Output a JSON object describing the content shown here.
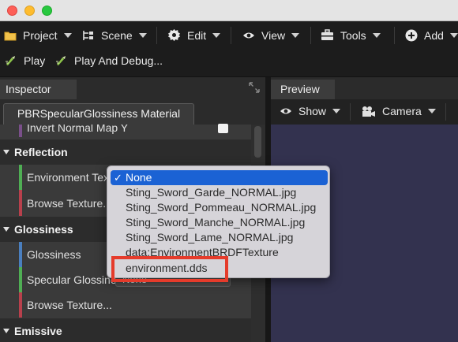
{
  "toolbar": {
    "project": "Project",
    "scene": "Scene",
    "edit": "Edit",
    "view": "View",
    "tools": "Tools",
    "add": "Add",
    "play": "Play",
    "play_debug": "Play And Debug..."
  },
  "inspector": {
    "tab": "Inspector",
    "material_tab": "PBRSpecularGlossiness Material",
    "rows": {
      "invert_normal": "Invert Normal Map Y",
      "reflection": "Reflection",
      "environment_texture": "Environment Texture",
      "browse_texture_1": "Browse Texture...",
      "glossiness_section": "Glossiness",
      "glossiness": "Glossiness",
      "specular_glossiness": "Specular Glossiness",
      "browse_texture_2": "Browse Texture...",
      "emissive": "Emissive"
    },
    "field_behind": "None"
  },
  "preview": {
    "tab": "Preview",
    "show": "Show",
    "camera": "Camera"
  },
  "menu": {
    "items": [
      "None",
      "Sting_Sword_Garde_NORMAL.jpg",
      "Sting_Sword_Pommeau_NORMAL.jpg",
      "Sting_Sword_Manche_NORMAL.jpg",
      "Sting_Sword_Lame_NORMAL.jpg",
      "data:EnvironmentBRDFTexture",
      "environment.dds"
    ],
    "checkmark": "✓"
  },
  "colors": {
    "accent_green": "#4fae54",
    "accent_red": "#b8404c",
    "accent_blue": "#4a7fbf",
    "selection": "#1b62d4",
    "callout": "#e53b2b"
  },
  "icons": [
    "folder-icon",
    "scene-tree-icon",
    "gear-icon",
    "eye-icon",
    "toolbox-icon",
    "plus-circle-icon",
    "play-icon",
    "expand-icon",
    "camera-icon"
  ]
}
